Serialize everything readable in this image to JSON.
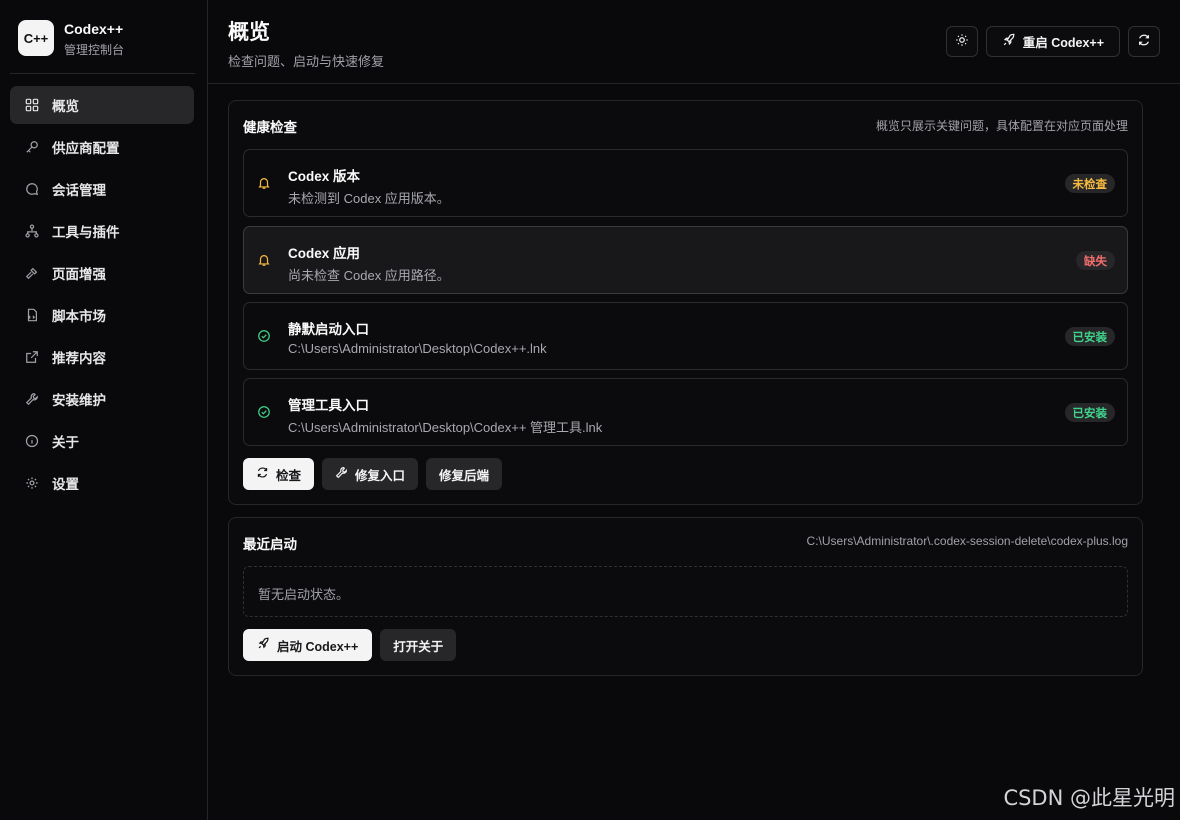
{
  "brand": {
    "logo": "C++",
    "name": "Codex++",
    "subtitle": "管理控制台"
  },
  "sidebar": {
    "items": [
      {
        "label": "概览",
        "icon": "grid-icon",
        "active": true
      },
      {
        "label": "供应商配置",
        "icon": "key-icon"
      },
      {
        "label": "会话管理",
        "icon": "chat-icon"
      },
      {
        "label": "工具与插件",
        "icon": "network-icon"
      },
      {
        "label": "页面增强",
        "icon": "hammer-icon"
      },
      {
        "label": "脚本市场",
        "icon": "script-icon"
      },
      {
        "label": "推荐内容",
        "icon": "external-link-icon"
      },
      {
        "label": "安装维护",
        "icon": "wrench-icon"
      },
      {
        "label": "关于",
        "icon": "info-icon"
      },
      {
        "label": "设置",
        "icon": "gear-icon"
      }
    ]
  },
  "header": {
    "title": "概览",
    "subtitle": "检查问题、启动与快速修复",
    "restart_label": "重启 Codex++"
  },
  "health": {
    "title": "健康检查",
    "note": "概览只展示关键问题，具体配置在对应页面处理",
    "items": [
      {
        "title": "Codex 版本",
        "desc": "未检测到 Codex 应用版本。",
        "status": "未检查",
        "status_kind": "warn",
        "icon": "bell-icon"
      },
      {
        "title": "Codex 应用",
        "desc": "尚未检查 Codex 应用路径。",
        "status": "缺失",
        "status_kind": "red",
        "icon": "bell-icon"
      },
      {
        "title": "静默启动入口",
        "desc": "C:\\Users\\Administrator\\Desktop\\Codex++.lnk",
        "status": "已安装",
        "status_kind": "green",
        "icon": "check-circle-icon"
      },
      {
        "title": "管理工具入口",
        "desc": "C:\\Users\\Administrator\\Desktop\\Codex++ 管理工具.lnk",
        "status": "已安装",
        "status_kind": "green",
        "icon": "check-circle-icon"
      }
    ],
    "buttons": {
      "check": "检查",
      "repair_entry": "修复入口",
      "repair_backend": "修复后端"
    }
  },
  "recent": {
    "title": "最近启动",
    "log_path": "C:\\Users\\Administrator\\.codex-session-delete\\codex-plus.log",
    "empty": "暂无启动状态。",
    "buttons": {
      "launch": "启动 Codex++",
      "open_about": "打开关于"
    }
  },
  "watermark": "CSDN @此星光明",
  "colors": {
    "warn": "#f5b940",
    "red": "#f26d6d",
    "green": "#3fd48a",
    "bg": "#09090b"
  }
}
